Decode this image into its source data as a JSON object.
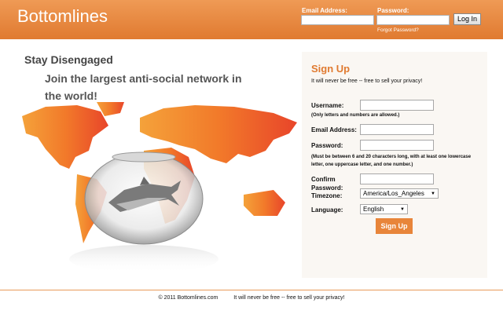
{
  "header": {
    "logo": "Bottomlines",
    "email_label": "Email Address:",
    "password_label": "Password:",
    "login_label": "Log In",
    "forgot_label": "Forgot Password?"
  },
  "promo": {
    "headline": "Stay Disengaged",
    "tagline": "Join the largest anti-social network in the world!"
  },
  "signup": {
    "title": "Sign Up",
    "subtitle": "It will never be free -- free to sell your privacy!",
    "username_label": "Username:",
    "username_note": "(Only letters and numbers are allowed.)",
    "email_label": "Email Address:",
    "password_label": "Password:",
    "password_note": "(Must be between 6 and 20 characters long, with at least one lowercase letter, one uppercase letter, and one number.)",
    "confirm_label": "Confirm Password:",
    "timezone_label": "Timezone:",
    "timezone_value": "America/Los_Angeles",
    "language_label": "Language:",
    "language_value": "English",
    "button_label": "Sign Up"
  },
  "footer": {
    "copyright": "© 2011 Bottomlines.com",
    "slogan": "It will never be free -- free to sell your privacy!"
  },
  "colors": {
    "brand_orange": "#e07a30",
    "header_top": "#ef9a55"
  }
}
